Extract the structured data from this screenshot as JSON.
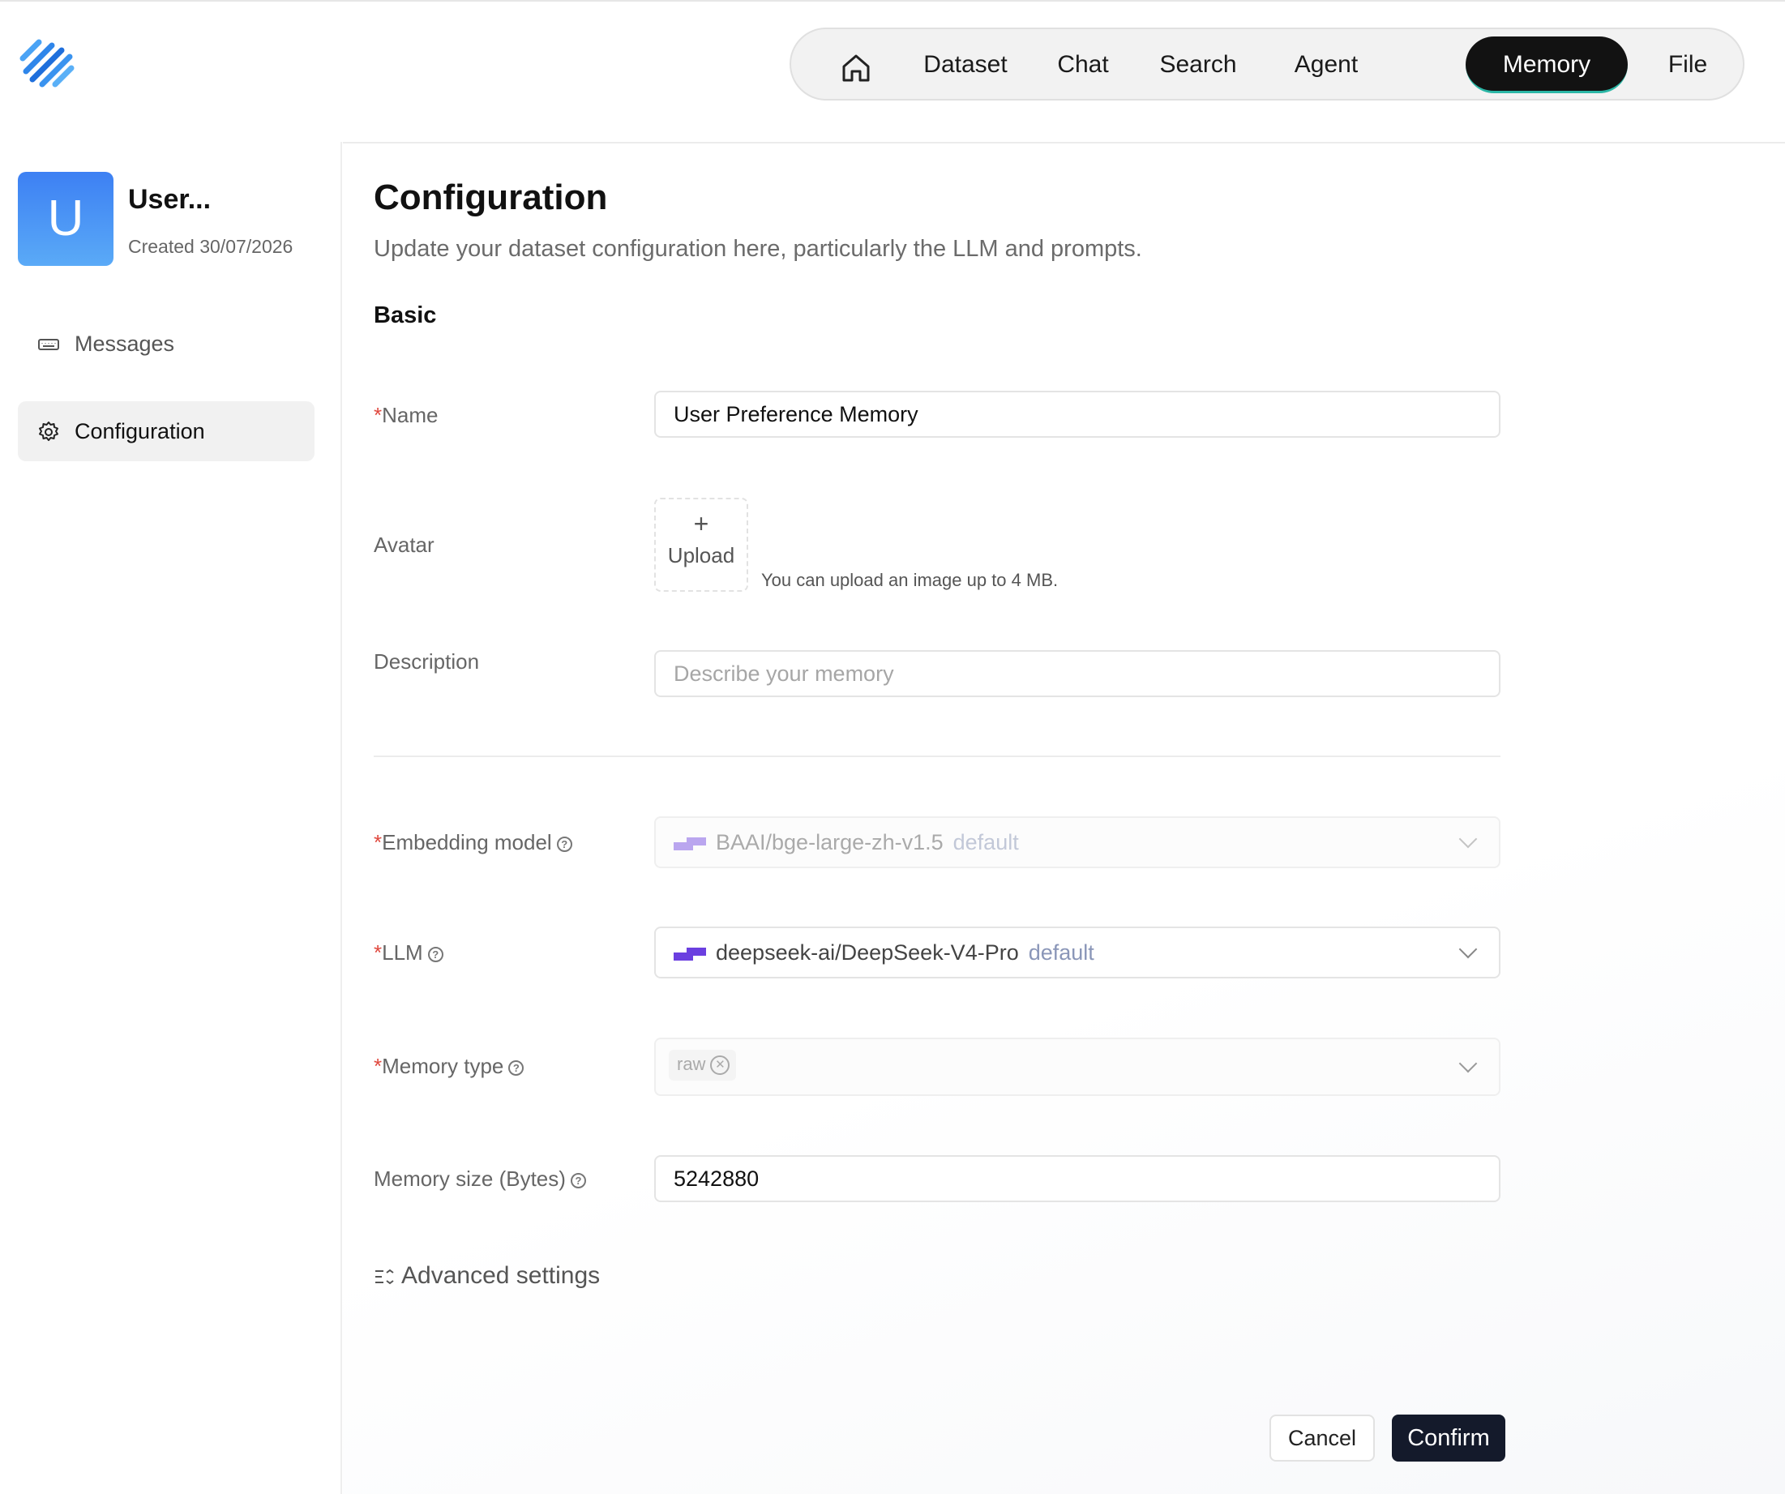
{
  "nav": {
    "items": [
      {
        "label": "Dataset"
      },
      {
        "label": "Chat"
      },
      {
        "label": "Search"
      },
      {
        "label": "Agent"
      },
      {
        "label": "Memory",
        "active": true
      },
      {
        "label": "File"
      }
    ]
  },
  "sidebar": {
    "avatar_letter": "U",
    "title": "User...",
    "created": "Created 30/07/2026",
    "items": [
      {
        "label": "Messages",
        "icon": "keyboard-icon"
      },
      {
        "label": "Configuration",
        "icon": "gear-icon",
        "active": true
      }
    ]
  },
  "main": {
    "title": "Configuration",
    "subtitle": "Update your dataset configuration here, particularly the LLM and prompts.",
    "section_basic": "Basic",
    "form": {
      "name_label": "Name",
      "name_value": "User Preference Memory",
      "avatar_label": "Avatar",
      "upload_label": "Upload",
      "upload_hint": "You can upload an image up to 4 MB.",
      "description_label": "Description",
      "description_placeholder": "Describe your memory",
      "embedding_label": "Embedding model",
      "embedding_value": "BAAI/bge-large-zh-v1.5",
      "embedding_tag": "default",
      "llm_label": "LLM",
      "llm_value": "deepseek-ai/DeepSeek-V4-Pro",
      "llm_tag": "default",
      "memory_type_label": "Memory type",
      "memory_type_chip": "raw",
      "memory_size_label": "Memory size (Bytes)",
      "memory_size_value": "5242880"
    },
    "advanced_label": "Advanced settings",
    "cancel_label": "Cancel",
    "confirm_label": "Confirm"
  },
  "colors": {
    "accent_dark": "#141a2b",
    "active_nav": "#121212",
    "required": "#e0483e",
    "avatar_gradient_top": "#3d80f3",
    "model_icon_purple": "#6b3fe0"
  }
}
